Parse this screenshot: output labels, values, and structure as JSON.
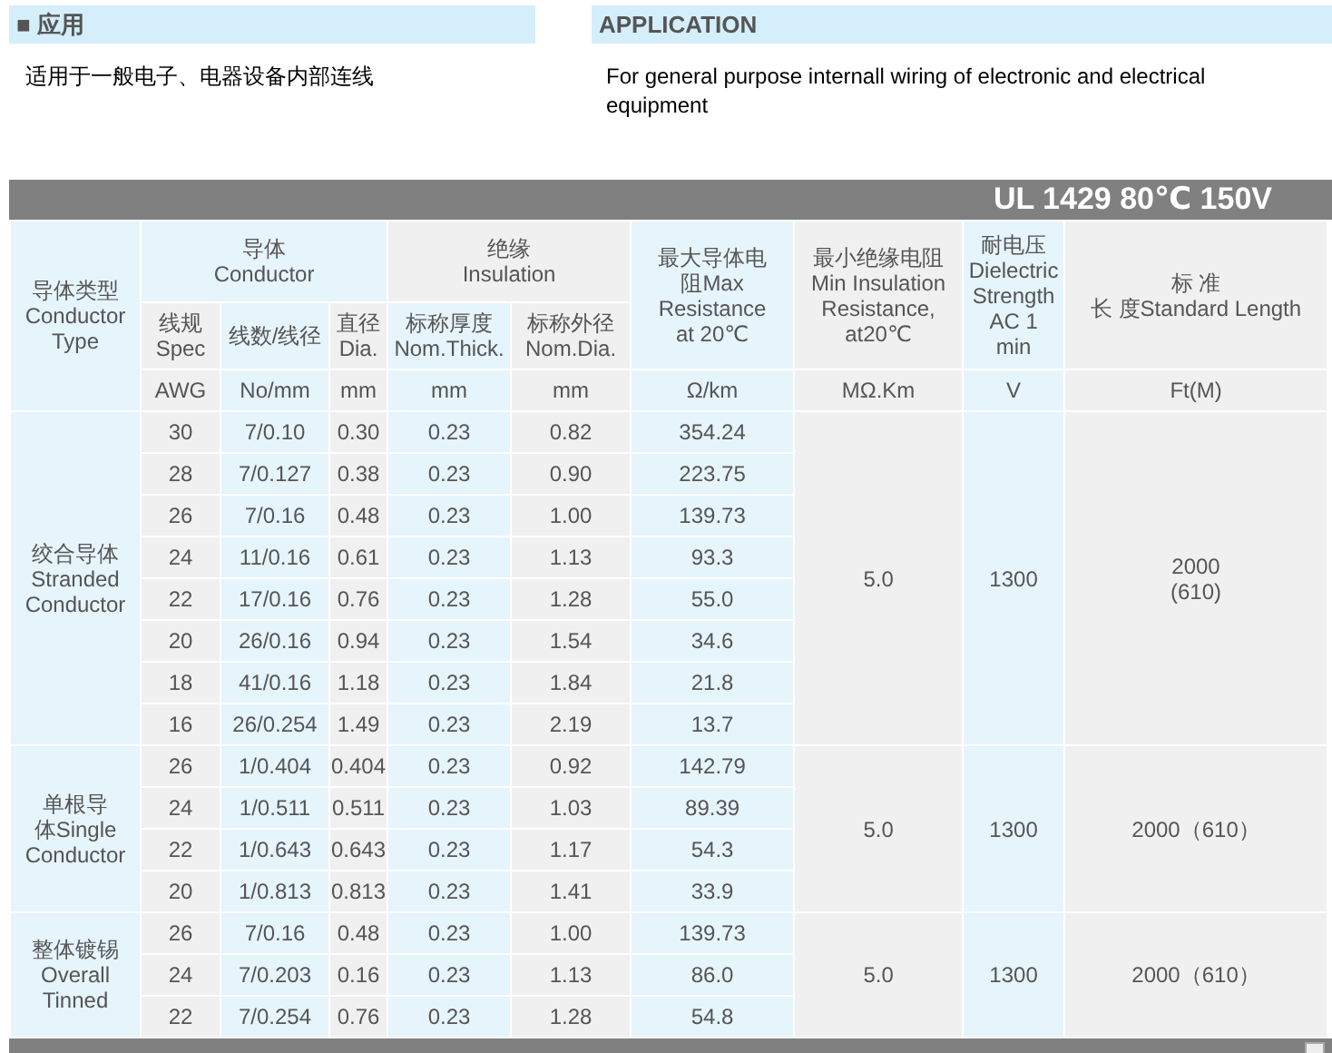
{
  "sections": [
    {
      "marker": "■",
      "title": "应用",
      "text": "适用于一般电子、电器设备内部连线"
    },
    {
      "title": "APPLICATION",
      "text": "For general purpose internall wiring of electronic and electrical equipment"
    }
  ],
  "table": {
    "title": "UL 1429 80℃ 150V",
    "header": {
      "type": [
        "导体类型",
        "Conductor",
        "Type"
      ],
      "conductor": [
        "导体",
        "Conductor"
      ],
      "insulation": [
        "绝缘",
        "Insulation"
      ],
      "resistance": [
        "最大导体电",
        "阻Max",
        "Resistance",
        "at 20℃"
      ],
      "min_insulation": [
        "最小绝缘电阻",
        "Min Insulation",
        "Resistance,",
        "at20℃"
      ],
      "dielectric": [
        "耐电压",
        "Dielectric",
        "Strength",
        "AC 1",
        "min"
      ],
      "length": [
        "标 准",
        "长 度Standard Length"
      ],
      "sub": [
        [
          "线规",
          "Spec"
        ],
        [
          "线数/线径"
        ],
        [
          "直径",
          "Dia."
        ],
        [
          "标称厚度",
          "Nom.Thick."
        ],
        [
          "标称外径",
          "Nom.Dia."
        ]
      ],
      "units": [
        "AWG",
        "No/mm",
        "mm",
        "mm",
        "mm",
        "Ω/km",
        "MΩ.Km",
        "V",
        "Ft(M)"
      ]
    },
    "groups": [
      {
        "type": [
          "绞合导体",
          "Stranded",
          "Conductor"
        ],
        "min_insulation": "5.0",
        "dielectric": "1300",
        "length_lines": [
          "2000",
          "(610)"
        ],
        "rows": [
          [
            "30",
            "7/0.10",
            "0.30",
            "0.23",
            "0.82",
            "354.24"
          ],
          [
            "28",
            "7/0.127",
            "0.38",
            "0.23",
            "0.90",
            "223.75"
          ],
          [
            "26",
            "7/0.16",
            "0.48",
            "0.23",
            "1.00",
            "139.73"
          ],
          [
            "24",
            "11/0.16",
            "0.61",
            "0.23",
            "1.13",
            "93.3"
          ],
          [
            "22",
            "17/0.16",
            "0.76",
            "0.23",
            "1.28",
            "55.0"
          ],
          [
            "20",
            "26/0.16",
            "0.94",
            "0.23",
            "1.54",
            "34.6"
          ],
          [
            "18",
            "41/0.16",
            "1.18",
            "0.23",
            "1.84",
            "21.8"
          ],
          [
            "16",
            "26/0.254",
            "1.49",
            "0.23",
            "2.19",
            "13.7"
          ]
        ]
      },
      {
        "type": [
          "单根导",
          "体Single",
          "Conductor"
        ],
        "min_insulation": "5.0",
        "dielectric": "1300",
        "length_lines": [
          "2000（610）"
        ],
        "rows": [
          [
            "26",
            "1/0.404",
            "0.404",
            "0.23",
            "0.92",
            "142.79"
          ],
          [
            "24",
            "1/0.511",
            "0.511",
            "0.23",
            "1.03",
            "89.39"
          ],
          [
            "22",
            "1/0.643",
            "0.643",
            "0.23",
            "1.17",
            "54.3"
          ],
          [
            "20",
            "1/0.813",
            "0.813",
            "0.23",
            "1.41",
            "33.9"
          ]
        ]
      },
      {
        "type": [
          "整体镀锡",
          "Overall",
          "Tinned"
        ],
        "min_insulation": "5.0",
        "dielectric": "1300",
        "length_lines": [
          "2000（610）"
        ],
        "rows": [
          [
            "26",
            "7/0.16",
            "0.48",
            "0.23",
            "1.00",
            "139.73"
          ],
          [
            "24",
            "7/0.203",
            "0.16",
            "0.23",
            "1.13",
            "86.0"
          ],
          [
            "22",
            "7/0.254",
            "0.76",
            "0.23",
            "1.28",
            "54.8"
          ]
        ]
      }
    ]
  }
}
